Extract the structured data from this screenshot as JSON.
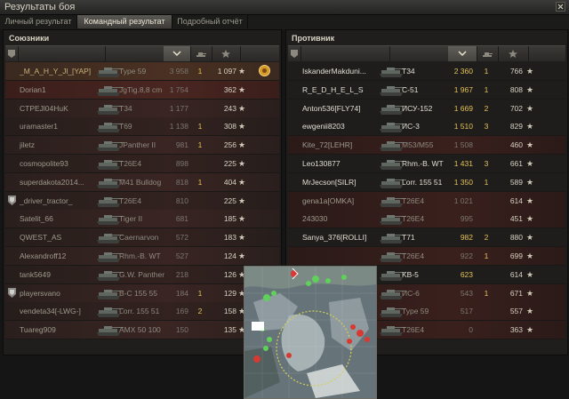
{
  "window": {
    "title": "Результаты боя"
  },
  "tabs": [
    {
      "label": "Личный результат",
      "active": false
    },
    {
      "label": "Командный результат",
      "active": true
    },
    {
      "label": "Подробный отчёт",
      "active": false
    }
  ],
  "allies": {
    "title": "Союзники",
    "rows": [
      {
        "player": "_M_A_H_Y_Jl_[YAP]",
        "tank": "Type 59",
        "damage": "3 958",
        "kills": "1",
        "xp": "1 097",
        "state": "me",
        "medal": true
      },
      {
        "player": "Dorian1",
        "tank": "JgTig.8,8 cm",
        "damage": "1 754",
        "kills": "",
        "xp": "362",
        "state": "dead"
      },
      {
        "player": "CTPEJl04HuK",
        "tank": "T34",
        "damage": "1 177",
        "kills": "",
        "xp": "243",
        "state": "normal"
      },
      {
        "player": "uramaster1",
        "tank": "T69",
        "damage": "1 138",
        "kills": "1",
        "xp": "308",
        "state": "alt"
      },
      {
        "player": "jiletz",
        "tank": "JPanther II",
        "damage": "981",
        "kills": "1",
        "xp": "256",
        "state": "normal"
      },
      {
        "player": "cosmopolite93",
        "tank": "T26E4",
        "damage": "898",
        "kills": "",
        "xp": "225",
        "state": "alt"
      },
      {
        "player": "superdakota2014...",
        "tank": "M41 Bulldog",
        "damage": "818",
        "kills": "1",
        "xp": "404",
        "state": "normal"
      },
      {
        "player": "_driver_tractor_",
        "tank": "T26E4",
        "damage": "810",
        "kills": "",
        "xp": "225",
        "state": "alt",
        "squad": true
      },
      {
        "player": "Satelit_66",
        "tank": "Tiger II",
        "damage": "681",
        "kills": "",
        "xp": "185",
        "state": "normal"
      },
      {
        "player": "QWEST_AS",
        "tank": "Caernarvon",
        "damage": "572",
        "kills": "",
        "xp": "183",
        "state": "alt"
      },
      {
        "player": "Alexandroff12",
        "tank": "Rhm.-B. WT",
        "damage": "527",
        "kills": "",
        "xp": "124",
        "state": "normal"
      },
      {
        "player": "tank5649",
        "tank": "G.W. Panther",
        "damage": "218",
        "kills": "",
        "xp": "126",
        "state": "alt"
      },
      {
        "player": "playersvano",
        "tank": "B-C 155 55",
        "damage": "184",
        "kills": "1",
        "xp": "129",
        "state": "normal",
        "squad": true
      },
      {
        "player": "vendeta34[-LWG-]",
        "tank": "Lorr. 155 51",
        "damage": "169",
        "kills": "2",
        "xp": "158",
        "state": "alt"
      },
      {
        "player": "Tuareg909",
        "tank": "AMX 50 100",
        "damage": "150",
        "kills": "",
        "xp": "135",
        "state": "normal"
      }
    ]
  },
  "enemies": {
    "title": "Противник",
    "rows": [
      {
        "player": "IskanderMakduni...",
        "tank": "T34",
        "damage": "2 360",
        "kills": "1",
        "xp": "766",
        "state": "alive"
      },
      {
        "player": "R_E_D_H_E_L_S",
        "tank": "C-51",
        "damage": "1 967",
        "kills": "1",
        "xp": "808",
        "state": "alive"
      },
      {
        "player": "Anton536[FLY74]",
        "tank": "ИСУ-152",
        "damage": "1 669",
        "kills": "2",
        "xp": "702",
        "state": "alive"
      },
      {
        "player": "ewgenii8203",
        "tank": "ИС-3",
        "damage": "1 510",
        "kills": "3",
        "xp": "829",
        "state": "alive"
      },
      {
        "player": "Kite_72[LEHR]",
        "tank": "M53/M55",
        "damage": "1 508",
        "kills": "",
        "xp": "460",
        "state": "dead"
      },
      {
        "player": "Leo130877",
        "tank": "Rhm.-B. WT",
        "damage": "1 431",
        "kills": "3",
        "xp": "661",
        "state": "alive"
      },
      {
        "player": "MrJecson[SILR]",
        "tank": "Lorr. 155 51",
        "damage": "1 350",
        "kills": "1",
        "xp": "589",
        "state": "alive"
      },
      {
        "player": "gena1a[OMKA]",
        "tank": "T26E4",
        "damage": "1 021",
        "kills": "",
        "xp": "614",
        "state": "dead"
      },
      {
        "player": "243030",
        "tank": "T26E4",
        "damage": "995",
        "kills": "",
        "xp": "451",
        "state": "dead"
      },
      {
        "player": "Sanya_376[ROLLI]",
        "tank": "T71",
        "damage": "982",
        "kills": "2",
        "xp": "880",
        "state": "alive"
      },
      {
        "player": "",
        "tank": "T26E4",
        "damage": "922",
        "kills": "1",
        "xp": "699",
        "state": "dead"
      },
      {
        "player": "",
        "tank": "KB-5",
        "damage": "623",
        "kills": "",
        "xp": "614",
        "state": "alive"
      },
      {
        "player": "",
        "tank": "ИС-6",
        "damage": "543",
        "kills": "1",
        "xp": "671",
        "state": "dead"
      },
      {
        "player": "",
        "tank": "Type 59",
        "damage": "517",
        "kills": "",
        "xp": "557",
        "state": "dead"
      },
      {
        "player": "",
        "tank": "T26E4",
        "damage": "0",
        "kills": "",
        "xp": "363",
        "state": "dead"
      }
    ]
  },
  "icons": {
    "close": "close-icon",
    "squad": "squad-icon",
    "medal": "medal-icon",
    "star": "★",
    "sort": "chevron-down-icon"
  },
  "colors": {
    "accent": "#e4c256",
    "ally_row": "#3a2523",
    "enemy_row": "#1e1d1c"
  }
}
